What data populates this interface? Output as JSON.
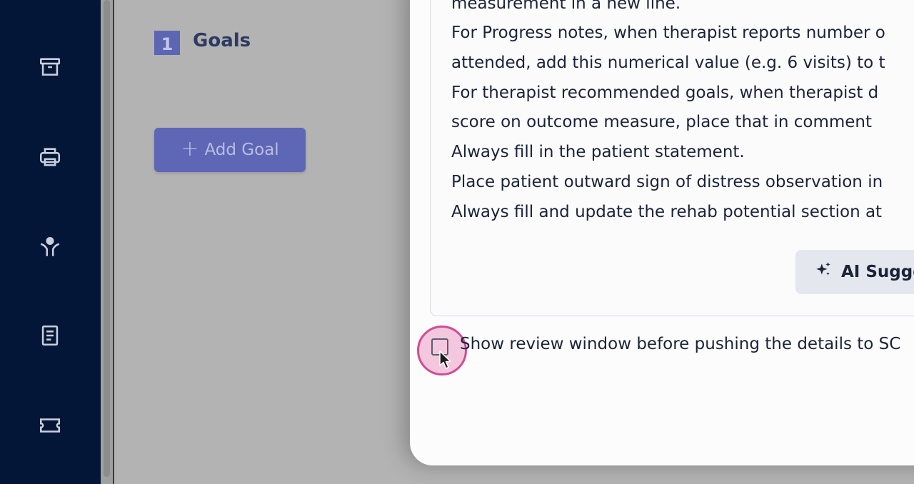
{
  "sidebar": {
    "items": [
      {
        "icon": "archive-icon"
      },
      {
        "icon": "printer-icon"
      },
      {
        "icon": "person-icon"
      },
      {
        "icon": "document-icon"
      },
      {
        "icon": "ticket-icon"
      }
    ]
  },
  "goals": {
    "number": "1",
    "title": "Goals",
    "add_button_icon": "+",
    "add_button_label": "Add Goal"
  },
  "modal": {
    "instruction_lines": [
      "measurement in a new line.",
      "For Progress notes, when therapist reports number o",
      "attended, add this numerical value (e.g. 6 visits) to t",
      "For therapist recommended goals, when therapist d",
      "score on outcome measure, place that in comment",
      "Always fill in the patient statement.",
      "Place patient outward sign of distress observation in",
      "Always fill and update the rehab potential section at"
    ],
    "ai_button_label": "AI Sugge",
    "review_checkbox_label": "Show review window before pushing the details to SC",
    "review_checkbox_checked": false
  },
  "colors": {
    "sidebar_bg": "#031637",
    "accent": "#5d67b6",
    "highlight_ring": "#d24c92"
  }
}
